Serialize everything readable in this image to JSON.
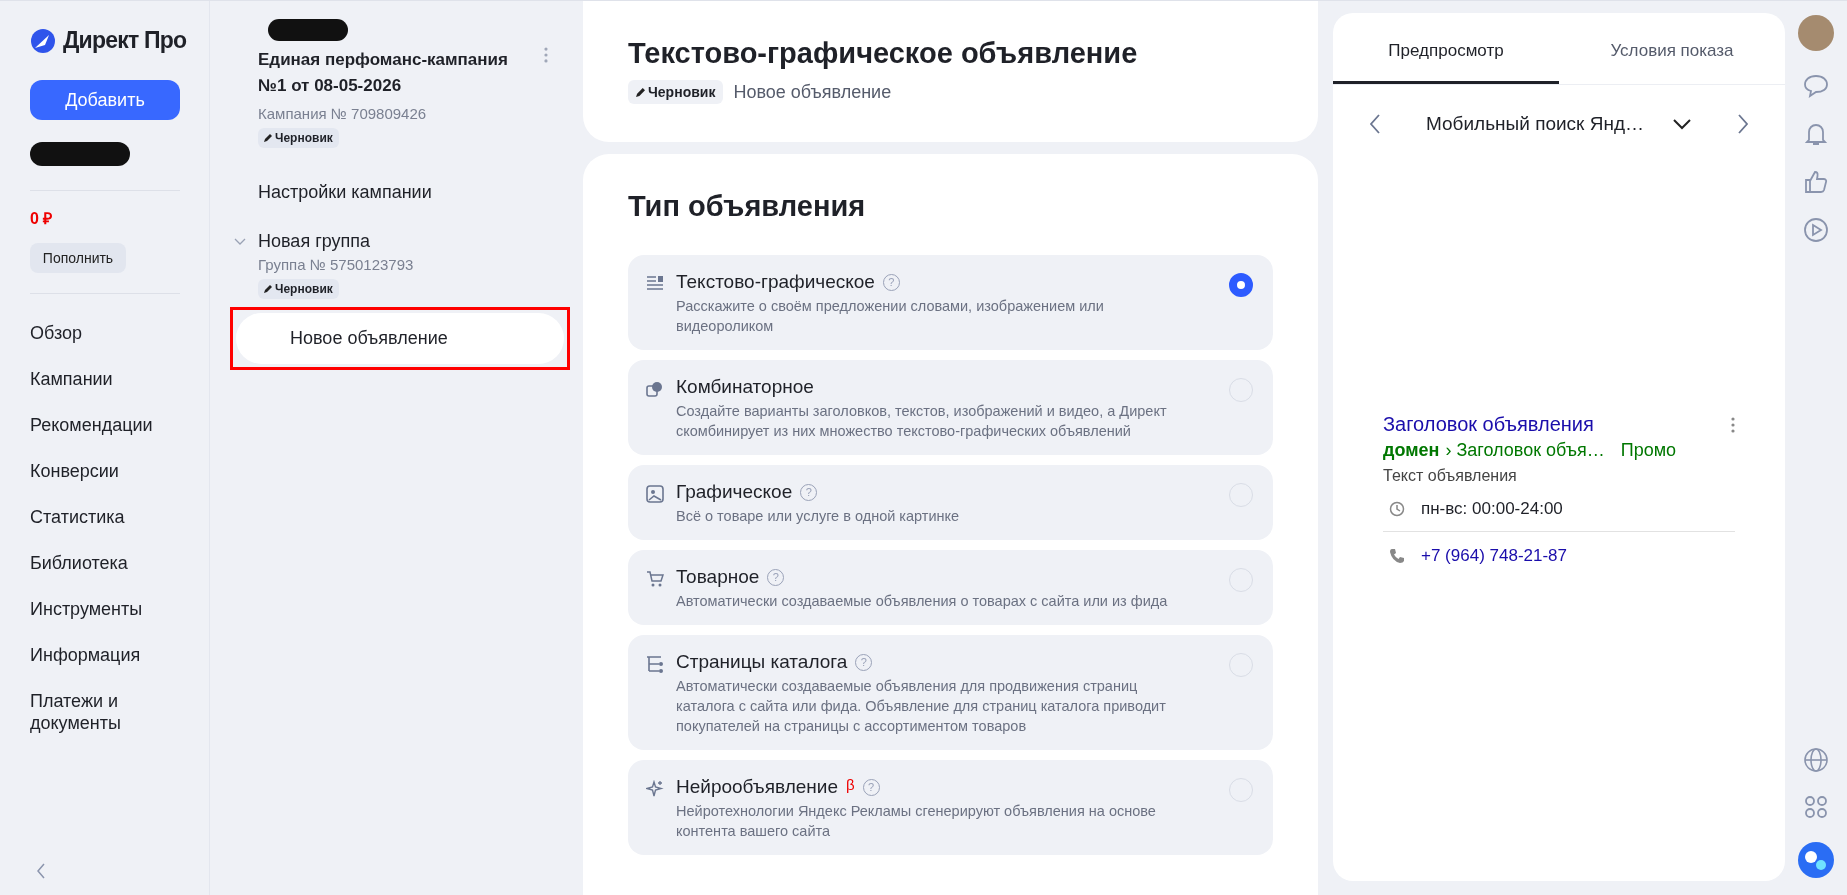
{
  "logo": {
    "name": "Директ Про"
  },
  "sidebar": {
    "add_button": "Добавить",
    "balance": "0 ₽",
    "topup_button": "Пополнить",
    "items": [
      {
        "label": "Обзор"
      },
      {
        "label": "Кампании"
      },
      {
        "label": "Рекомендации"
      },
      {
        "label": "Конверсии"
      },
      {
        "label": "Статистика"
      },
      {
        "label": "Библиотека"
      },
      {
        "label": "Инструменты"
      },
      {
        "label": "Информация"
      },
      {
        "label": "Платежи и документы"
      }
    ]
  },
  "campaign_tree": {
    "title": "Единая перфоманс-кампания №1 от 08-05-2026",
    "number": "Кампания № 709809426",
    "status": "Черновик",
    "settings_link": "Настройки кампании",
    "groups": [
      {
        "name": "Новая группа",
        "number": "Группа № 5750123793",
        "status": "Черновик",
        "expanded": true,
        "children": [
          {
            "name": "Новое объявление",
            "selected": true,
            "highlighted": true
          }
        ]
      }
    ]
  },
  "header": {
    "title": "Текстово-графическое объявление",
    "status": "Черновик",
    "subtitle": "Новое объявление"
  },
  "ad_type": {
    "title": "Тип объявления",
    "options": [
      {
        "kind": "text",
        "title": "Текстово-графическое",
        "help": "?",
        "description": "Расскажите о своём предложении словами, изображением или видеороликом",
        "selected": true
      },
      {
        "kind": "combo",
        "title": "Комбинаторное",
        "description": "Создайте варианты заголовков, текстов, изображений и видео, а Директ скомбинирует из них множество текстово-графических объявлений",
        "selected": false
      },
      {
        "kind": "image",
        "title": "Графическое",
        "help": "?",
        "description": "Всё о товаре или услуге в одной картинке",
        "selected": false
      },
      {
        "kind": "cart",
        "title": "Товарное",
        "help": "?",
        "description": "Автоматически создаваемые объявления о товарах с сайта или из фида",
        "selected": false
      },
      {
        "kind": "catalog",
        "title": "Страницы каталога",
        "help": "?",
        "description": "Автоматически создаваемые объявления для продвижения страниц каталога с сайта или фида. Объявление для страниц каталога приводит покупателей на страницы с ассортиментом товаров",
        "selected": false
      },
      {
        "kind": "neuro",
        "title": "Нейрообъявление",
        "beta": "β",
        "help": "?",
        "description": "Нейротехнологии Яндекс Рекламы сгенерируют объявления на основе контента вашего сайта",
        "selected": false
      }
    ]
  },
  "preview": {
    "tabs": [
      {
        "label": "Предпросмотр",
        "selected": true
      },
      {
        "label": "Условия показа",
        "selected": false
      }
    ],
    "device": "Мобильный поиск Янд…",
    "ad": {
      "title": "Заголовок объявления",
      "domain": "домен",
      "path": "› Заголовок объя…",
      "promo": "Промо",
      "text": "Текст объявления",
      "hours": "пн-вс: 00:00-24:00",
      "phone": "+7 (964) 748-21-87"
    }
  }
}
